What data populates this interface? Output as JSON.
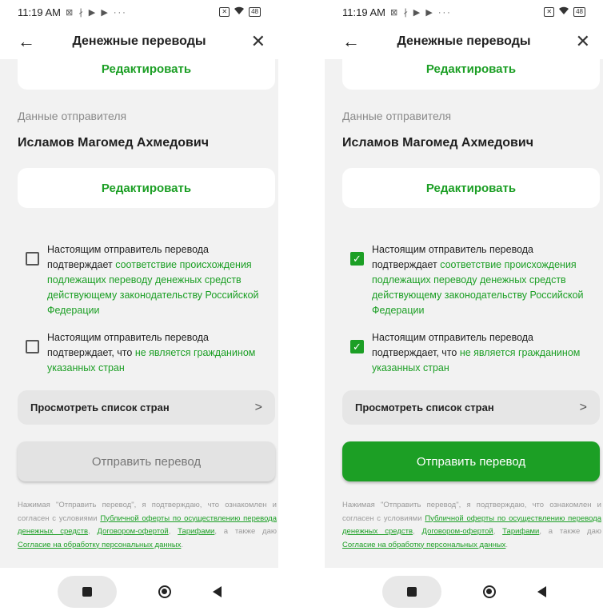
{
  "status": {
    "time": "11:19 AM",
    "left_icons": "⊠ ∤ ▶ ▶ ···",
    "battery": "48",
    "sim": "✕"
  },
  "header": {
    "title": "Денежные переводы",
    "back_icon": "←",
    "close_icon": "✕"
  },
  "labels": {
    "edit": "Редактировать",
    "sender_section": "Данные отправителя",
    "sender_name": "Исламов Магомед Ахмедович"
  },
  "checks": {
    "c1_a": "Настоящим отправитель перевода подтверждает ",
    "c1_b": "соответствие происхождения подлежащих переводу денежных средств действующему законодательству Российской Федерации",
    "c2_a": "Настоящим отправитель перевода подтверждает, что ",
    "c2_b": "не является гражданином указанных стран",
    "check_mark": "✓"
  },
  "countries": {
    "label": "Просмотреть список стран",
    "chevron": ">"
  },
  "send": {
    "label": "Отправить перевод"
  },
  "legal": {
    "t1": "Нажимая \"Отправить перевод\", я подтверждаю, что ознакомлен и согласен с условиями ",
    "l1": "Публичной оферты по осуществлению перевода денежных средств",
    "t2": ", ",
    "l2": "Договором-офертой",
    "t3": ", ",
    "l3": "Тарифами",
    "t4": ", а также даю ",
    "l4": "Согласие на обработку персональных данных",
    "t5": "."
  },
  "screens": [
    {
      "state": "unchecked",
      "checkbox1": false,
      "checkbox2": false,
      "send_enabled": false
    },
    {
      "state": "checked",
      "checkbox1": true,
      "checkbox2": true,
      "send_enabled": true
    }
  ],
  "colors": {
    "accent": "#1c9f25",
    "background": "#f2f2f2",
    "disabled_button": "#e3e3e3"
  }
}
